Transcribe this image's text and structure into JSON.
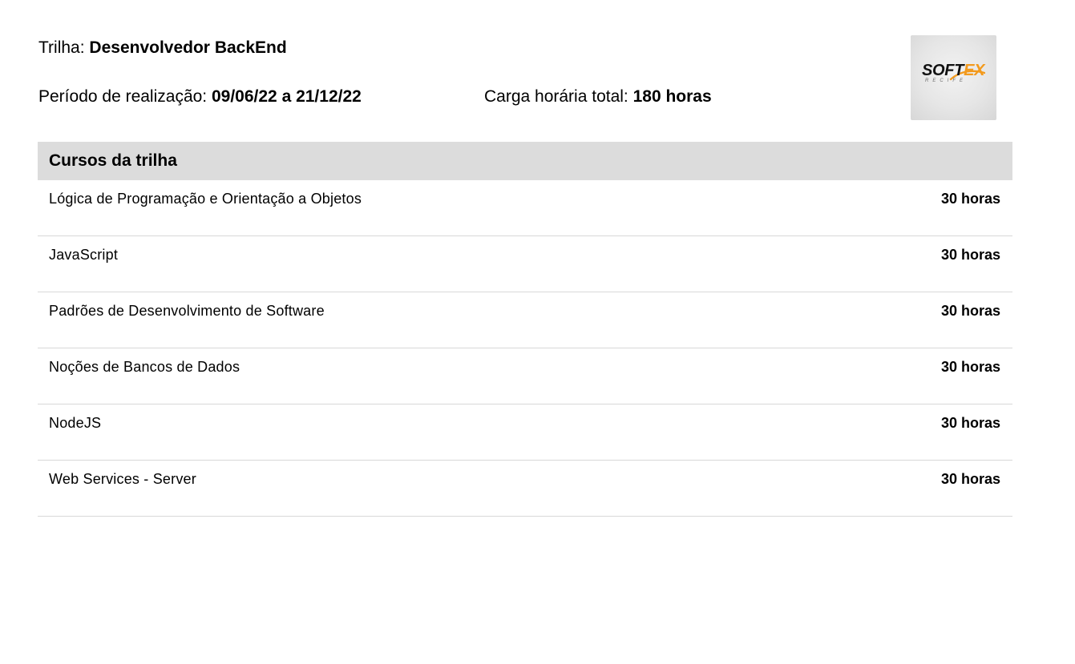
{
  "track": {
    "label": "Trilha:",
    "value": "Desenvolvedor BackEnd"
  },
  "period": {
    "label": "Período de realização:",
    "value": "09/06/22 a 21/12/22"
  },
  "total_hours": {
    "label": "Carga horária total:",
    "value": "180 horas"
  },
  "logo": {
    "main_left": "SOFT",
    "main_right": "EX",
    "subtitle": "RECIFE",
    "accent_color": "#f39a1d"
  },
  "courses": {
    "header": "Cursos da trilha",
    "rows": [
      {
        "name": "Lógica de Programação e Orientação a Objetos",
        "hours": "30 horas"
      },
      {
        "name": "JavaScript",
        "hours": "30 horas"
      },
      {
        "name": "Padrões de Desenvolvimento de Software",
        "hours": "30 horas"
      },
      {
        "name": "Noções de Bancos de Dados",
        "hours": "30 horas"
      },
      {
        "name": "NodeJS",
        "hours": "30 horas"
      },
      {
        "name": "Web Services - Server",
        "hours": "30 horas"
      }
    ]
  }
}
